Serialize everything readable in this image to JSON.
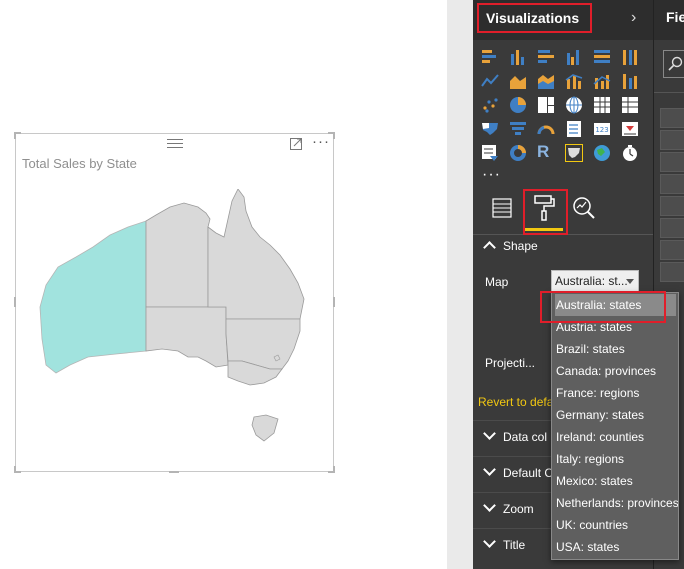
{
  "visual": {
    "title": "Total Sales by State",
    "focus_icon": "focus-mode-icon",
    "more_label": "···",
    "highlight_color": "#a1e3de",
    "region_color": "#d9d9d9"
  },
  "viz_pane": {
    "title": "Visualizations",
    "collapse_icon": "chevron-right-icon",
    "more_visuals": "···",
    "tabs": [
      "fields-tab-icon",
      "format-paintbrush-icon",
      "analytics-icon"
    ],
    "selected_tab": "format-paintbrush-icon"
  },
  "format": {
    "shape_section": "Shape",
    "map_label": "Map",
    "map_value": "Australia: st...",
    "projection_label": "Projecti...",
    "revert_label": "Revert to defa",
    "sections": [
      "Data col",
      "Default C",
      "Zoom",
      "Title"
    ]
  },
  "dropdown": {
    "options": [
      "Australia: states",
      "Austria: states",
      "Brazil: states",
      "Canada: provinces",
      "France: regions",
      "Germany: states",
      "Ireland: counties",
      "Italy: regions",
      "Mexico: states",
      "Netherlands: provinces",
      "UK: countries",
      "USA: states"
    ],
    "selected": "Australia: states"
  },
  "fields_pane": {
    "title": "Fie"
  },
  "colors": {
    "accent_yellow": "#f2c811",
    "annotation_red": "#e01e2a",
    "pane_bg": "#3a3a3a"
  }
}
